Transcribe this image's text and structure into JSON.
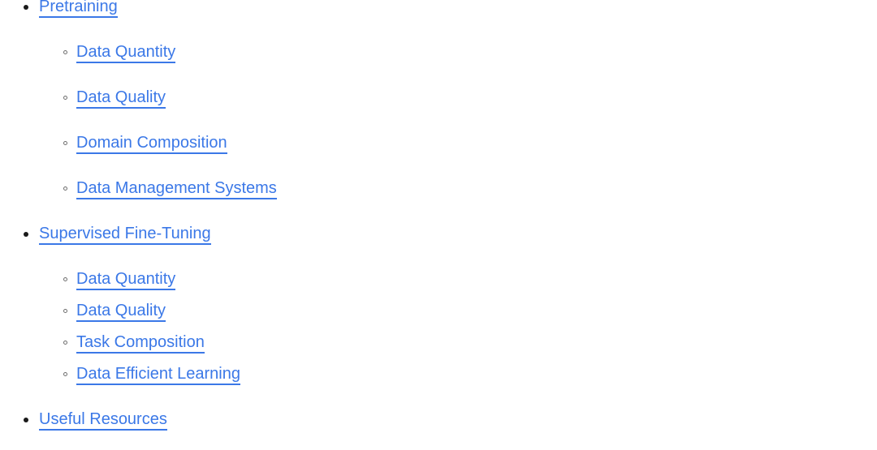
{
  "page": {
    "kind": "table-of-contents",
    "background_color": "#ffffff",
    "link_color": "#3b78e7",
    "bullet_level1_color": "#1a1a1a",
    "bullet_level2_color": "#6e6e6e",
    "bullet_level1_marker": "filled-disc",
    "bullet_level2_marker": "hollow-circle"
  },
  "toc": {
    "sections": [
      {
        "label": "Pretraining",
        "items": [
          {
            "label": "Data Quantity"
          },
          {
            "label": "Data Quality"
          },
          {
            "label": "Domain Composition"
          },
          {
            "label": "Data Management Systems"
          }
        ]
      },
      {
        "label": "Supervised Fine-Tuning",
        "items": [
          {
            "label": "Data Quantity"
          },
          {
            "label": "Data Quality"
          },
          {
            "label": "Task Composition"
          },
          {
            "label": "Data Efficient Learning"
          }
        ]
      },
      {
        "label": "Useful Resources",
        "items": []
      }
    ]
  }
}
